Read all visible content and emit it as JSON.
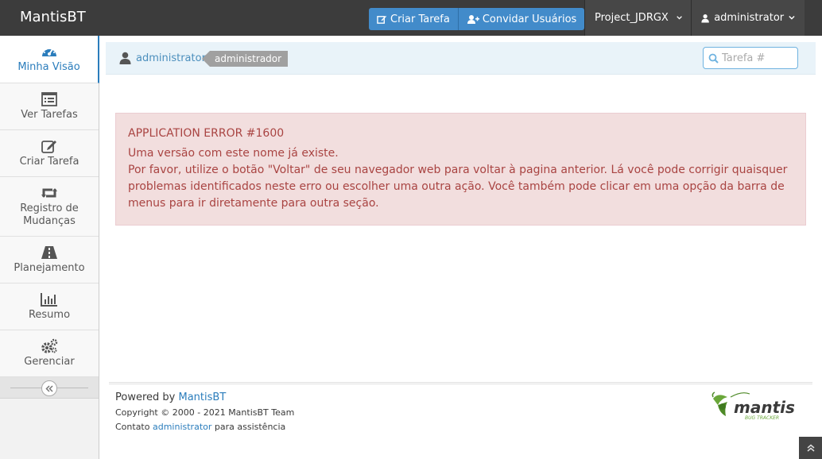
{
  "app": {
    "brand": "MantisBT"
  },
  "navbar": {
    "create_issue": "Criar Tarefa",
    "invite_users": "Convidar Usuários",
    "project": "Project_JDRGX",
    "user": "administrator"
  },
  "sidebar": {
    "items": [
      {
        "label": "Minha Visão",
        "icon": "dashboard-icon",
        "active": true
      },
      {
        "label": "Ver Tarefas",
        "icon": "list-icon"
      },
      {
        "label": "Criar Tarefa",
        "icon": "edit-icon"
      },
      {
        "label": "Registro de Mudanças",
        "icon": "retweet-icon"
      },
      {
        "label": "Planejamento",
        "icon": "road-icon"
      },
      {
        "label": "Resumo",
        "icon": "bar-chart-icon"
      },
      {
        "label": "Gerenciar",
        "icon": "gears-icon"
      }
    ]
  },
  "breadcrumb": {
    "user_link": "administrator",
    "access_level": "administrador"
  },
  "search": {
    "placeholder": "Tarefa #"
  },
  "error": {
    "title": "APPLICATION ERROR #1600",
    "message": "Uma versão com este nome já existe.",
    "hint": "Por favor, utilize o botão \"Voltar\" de seu navegador web para voltar à pagina anterior. Lá você pode corrigir quaisquer problemas identificados neste erro ou escolher uma outra ação. Você também pode clicar em uma opção da barra de menus para ir diretamente para outra seção."
  },
  "footer": {
    "powered_by": "Powered by",
    "powered_link": "MantisBT",
    "copyright": "Copyright © 2000 - 2021 MantisBT Team",
    "contact_prefix": "Contato",
    "contact_link": "administrator",
    "contact_suffix": "para assistência",
    "logo_main": "mantis",
    "logo_sub": "BUG TRACKER"
  },
  "colors": {
    "navbar": "#3c3c3c",
    "primary": "#428bca",
    "link": "#4c8fbd",
    "error_bg": "#f2dede",
    "error_text": "#a94442"
  }
}
